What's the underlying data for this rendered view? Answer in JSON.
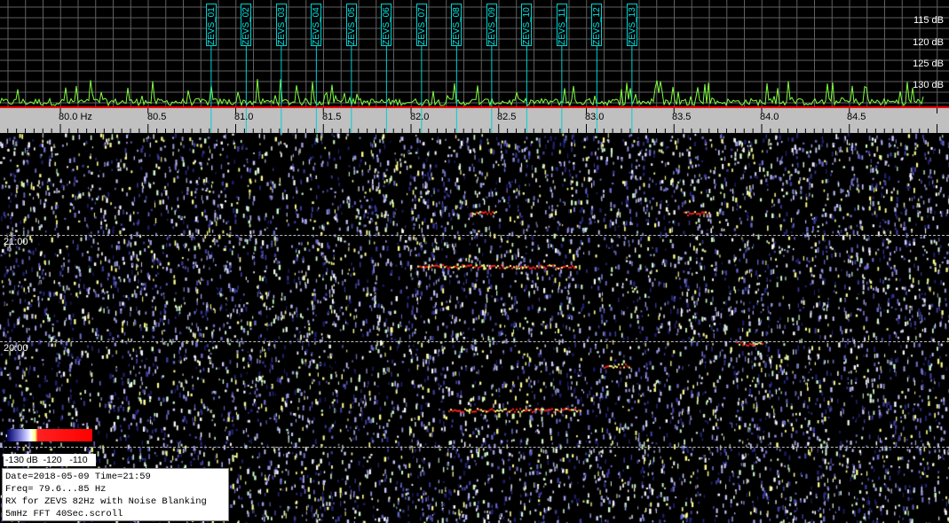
{
  "spectrum": {
    "db_labels": [
      "115 dB",
      "120 dB",
      "125 dB",
      "130 dB"
    ]
  },
  "markers": [
    "ZEVS_01",
    "ZEVS_02",
    "ZEVS_03",
    "ZEVS_04",
    "ZEVS_05",
    "ZEVS_06",
    "ZEVS_07",
    "ZEVS_08",
    "ZEVS_09",
    "ZEVS_10",
    "ZEVS_11",
    "ZEVS_12",
    "ZEVS_13"
  ],
  "frequency_axis": {
    "labels": [
      "80.0 Hz",
      "80.5",
      "81.0",
      "81.5",
      "82.0",
      "82.5",
      "83.0",
      "83.5",
      "84.0",
      "84.5"
    ]
  },
  "waterfall": {
    "time_labels": [
      "21:00",
      "20:00"
    ]
  },
  "colorbar": {
    "labels": "-130 dB  -120   -110"
  },
  "info": {
    "line1": "Date=2018-05-09 Time=21:59",
    "line2": "Freq= 79.6...85 Hz",
    "line3": "RX for ZEVS 82Hz with Noise Blanking",
    "line4": "5mHz FFT 40Sec.scroll"
  },
  "colors": {
    "marker": "#00d0d0",
    "spectrum_trace": "#80ff40",
    "baseline": "#ff0000"
  }
}
